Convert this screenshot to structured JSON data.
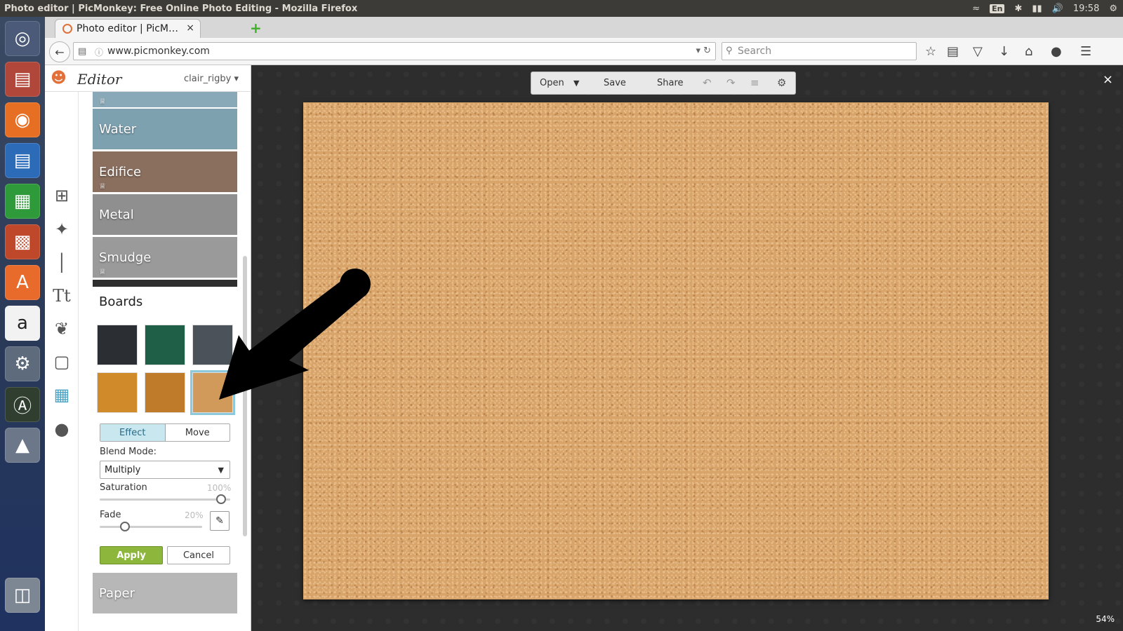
{
  "os": {
    "window_title": "Photo editor | PicMonkey: Free Online Photo Editing - Mozilla Firefox",
    "keyboard_layout": "En",
    "clock": "19:58"
  },
  "browser": {
    "tab_title": "Photo editor | PicM…",
    "tab_close": "×",
    "new_tab": "+",
    "url": "www.picmonkey.com",
    "search_placeholder": "Search"
  },
  "app": {
    "title": "Editor",
    "username": "clair_rigby",
    "textures": [
      {
        "label": "Water",
        "color": "#7ea1b0"
      },
      {
        "label": "Edifice",
        "color": "#8a6e5e"
      },
      {
        "label": "Metal",
        "color": "#8f8f8f"
      },
      {
        "label": "Smudge",
        "color": "#9a9a9a"
      }
    ],
    "section_title": "Boards",
    "board_swatches": [
      {
        "name": "blackboard",
        "color": "#2b2f33"
      },
      {
        "name": "greenboard",
        "color": "#1f5e47"
      },
      {
        "name": "chalk-scribble",
        "color": "#4b5259"
      },
      {
        "name": "orange-board",
        "color": "#d18a2a"
      },
      {
        "name": "woodgrain-board",
        "color": "#c07b2a"
      },
      {
        "name": "cork-board",
        "color": "#d29a5a",
        "selected": true
      }
    ],
    "mode_toggle": {
      "effect": "Effect",
      "move": "Move"
    },
    "blend_mode_label": "Blend Mode:",
    "blend_mode_value": "Multiply",
    "saturation_label": "Saturation",
    "saturation_value": "100%",
    "saturation_level": 100,
    "fade_label": "Fade",
    "fade_value": "20%",
    "fade_level": 20,
    "apply_label": "Apply",
    "cancel_label": "Cancel",
    "next_texture": "Paper"
  },
  "toolbar": {
    "open": "Open",
    "save": "Save",
    "share": "Share"
  },
  "workspace": {
    "close": "×",
    "zoom": "54%"
  },
  "colors": {
    "accent_green": "#8cb63c",
    "selection_blue": "#8cc9da",
    "brand_orange": "#e2703a"
  }
}
